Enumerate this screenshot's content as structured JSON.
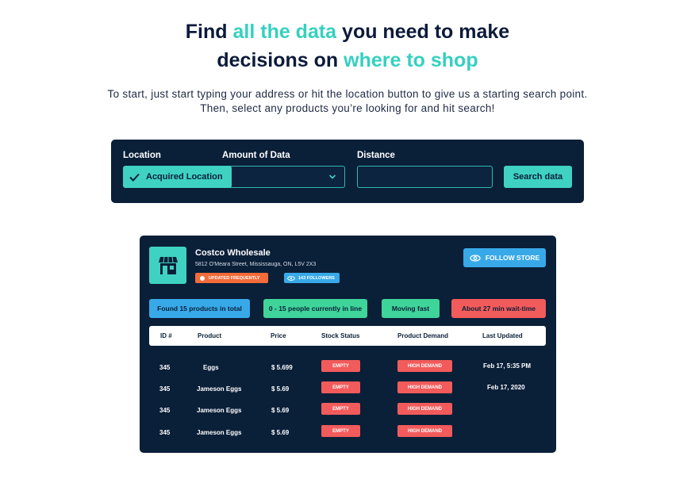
{
  "hero": {
    "line1_a": "Find ",
    "line1_accent": "all the data",
    "line1_b": " you need to make",
    "line2_a": "decisions on ",
    "line2_accent": "where to shop",
    "subtitle_1": "To start, just start typing your address or hit the location button to give us a starting search point.",
    "subtitle_2": "Then, select any products you’re looking for and hit search!"
  },
  "search": {
    "location_label": "Location",
    "amount_label": "Amount of Data",
    "distance_label": "Distance",
    "location_button": "Acquired Location",
    "amount_value": "",
    "distance_value": "",
    "search_button": "Search data"
  },
  "store": {
    "name": "Costco Wholesale",
    "address": "5812 O'Meara Street, Mississauga, ON, L5V 2X3",
    "updated_badge": "UPDATED FREQUENTLY",
    "followers_badge": "143 FOLLOWERS",
    "follow_button": "FOLLOW STORE",
    "stats": {
      "products": "Found 15 products in total",
      "people": "0 - 15 people currently in line",
      "speed": "Moving fast",
      "wait": "About 27 min wait-time"
    },
    "table": {
      "headers": [
        "ID #",
        "Product",
        "Price",
        "Stock Status",
        "Product Demand",
        "Last Updated"
      ],
      "rows": [
        {
          "id": "345",
          "product": "Eggs",
          "price": "$ 5.699",
          "stock": "EMPTY",
          "demand": "HIGH DEMAND",
          "updated": "Feb 17, 5:35 PM"
        },
        {
          "id": "345",
          "product": "Jameson Eggs",
          "price": "$ 5.69",
          "stock": "EMPTY",
          "demand": "HIGH DEMAND",
          "updated": "Feb 17, 2020"
        },
        {
          "id": "345",
          "product": "Jameson Eggs",
          "price": "$ 5.69",
          "stock": "EMPTY",
          "demand": "HIGH DEMAND",
          "updated": ""
        },
        {
          "id": "345",
          "product": "Jameson Eggs",
          "price": "$ 5.69",
          "stock": "EMPTY",
          "demand": "HIGH DEMAND",
          "updated": ""
        }
      ]
    }
  },
  "colors": {
    "accent": "#35d0c0",
    "panel": "#0a1f38",
    "blue": "#38a9e8",
    "green": "#3fd49a",
    "red": "#f25b5b",
    "orange": "#f26b3a"
  },
  "icons": {
    "location_button": "check-icon",
    "amount_select": "chevron-down-icon",
    "store": "storefront-icon",
    "updated_badge": "dot-icon",
    "followers_badge": "eye-icon",
    "follow_button": "eye-icon"
  }
}
